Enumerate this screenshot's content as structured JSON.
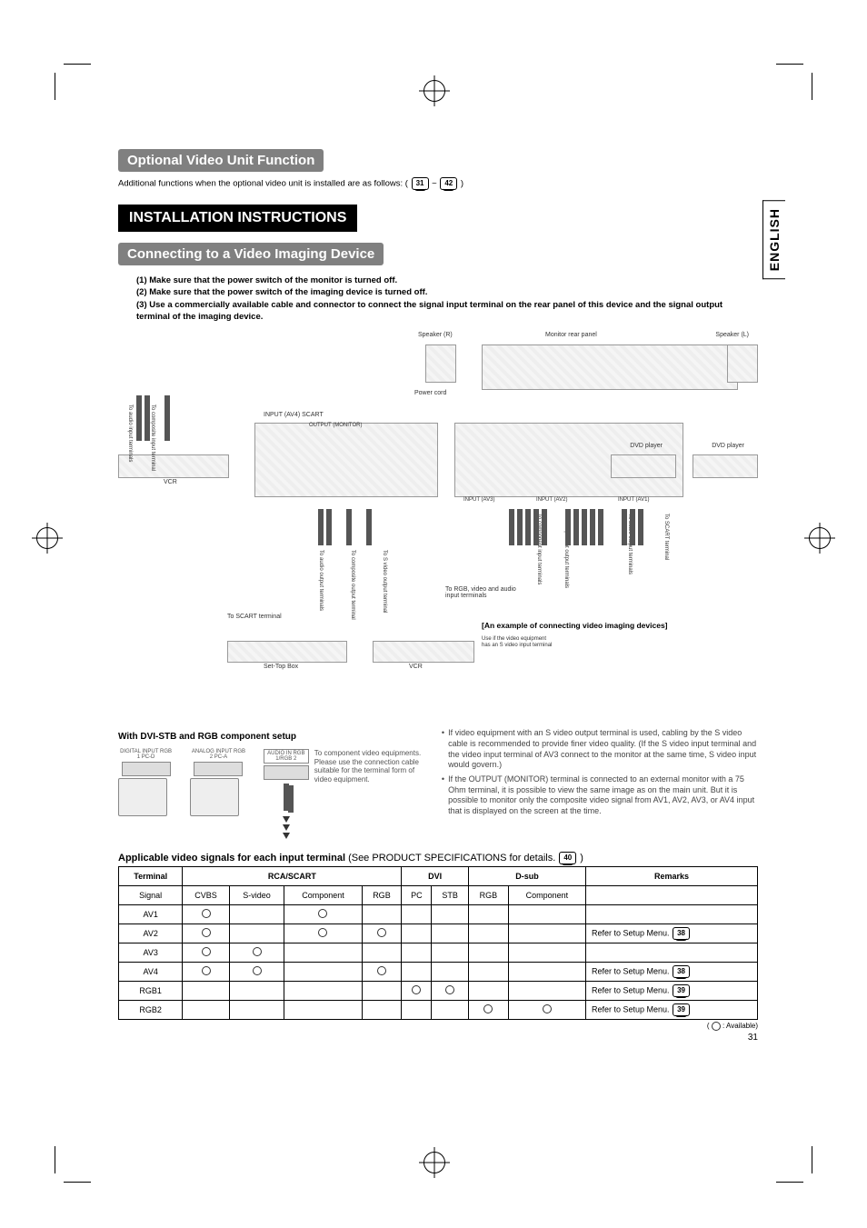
{
  "lang_tab": "ENGLISH",
  "sections": {
    "optional": "Optional Video Unit Function",
    "install": "INSTALLATION INSTRUCTIONS",
    "connect": "Connecting to a Video Imaging Device"
  },
  "additional_prefix": "Additional functions when the optional video unit is installed are as follows: (",
  "additional_p1": "31",
  "additional_sep": " ~ ",
  "additional_p2": "42",
  "additional_suffix": " )",
  "instructions": {
    "l1": "(1) Make sure that the power switch of the monitor is turned off.",
    "l2": "(2) Make sure that the power switch of the imaging device is turned off.",
    "l3": "(3) Use a commercially available cable and connector to connect the signal input terminal on the rear panel of this device and the signal output terminal of the imaging device."
  },
  "diagram": {
    "speaker_r": "Speaker (R)",
    "speaker_l": "Speaker (L)",
    "rear_panel": "Monitor rear panel",
    "power_cord": "Power cord",
    "vcr": "VCR",
    "vcr2": "VCR",
    "settop": "Set-Top Box",
    "dvd1": "DVD player",
    "dvd2": "DVD player",
    "example": "[An example of connecting video imaging devices]",
    "to_scart": "To SCART terminal",
    "to_audio_in": "To audio input terminals",
    "to_composite_in": "To composite input terminal",
    "to_audio_out": "To audio output terminals",
    "to_composite_out": "To composite output terminal",
    "to_svideo_out": "To S video output terminal",
    "to_rgb": "To RGB, video and audio input terminals",
    "to_comp_in": "To component input terminals",
    "to_comp_out": "To component output terminals",
    "to_audio_out2": "To audio output terminals",
    "to_scart2": "To SCART terminal",
    "svideo_note": "Use if the video equipment has an S video input terminal",
    "input_av4": "INPUT (AV4) SCART",
    "output_mon": "OUTPUT (MONITOR)",
    "input_av3": "INPUT (AV3)",
    "input_av2": "INPUT (AV2)",
    "input_av1": "INPUT (AV1)"
  },
  "setup": {
    "title": "With DVI-STB and RGB component setup",
    "labels": {
      "rgb1": "DIGITAL INPUT RGB 1 PC-D",
      "rgb2": "ANALOG INPUT RGB 2 PC-A",
      "audio": "AUDIO IN RGB 1/RGB 2"
    },
    "note": "To component video equipments. Please use the connection cable suitable for the terminal form of video equipment."
  },
  "right_notes": {
    "n1": "If video equipment with an S video output terminal is used, cabling by the S video cable is recommended to provide finer video quality. (If the S video input terminal and the video input terminal of AV3 connect to the monitor at the same time, S video input would govern.)",
    "n2": "If the OUTPUT (MONITOR) terminal is connected to an external monitor with a 75 Ohm terminal, it is possible to view the same image as on the main unit. But it is possible to monitor only the composite video signal from AV1, AV2, AV3, or AV4 input that is displayed on the screen at the time."
  },
  "table_title_prefix": "Applicable video signals for each input terminal ",
  "table_title_mid": "(See PRODUCT SPECIFICATIONS for details. ",
  "table_title_page": "40",
  "table_title_suffix": " )",
  "table": {
    "headers": {
      "terminal": "Terminal",
      "rca": "RCA/SCART",
      "dvi": "DVI",
      "dsub": "D-sub",
      "remarks": "Remarks",
      "signal": "Signal",
      "cvbs": "CVBS",
      "svideo": "S-video",
      "component": "Component",
      "rgb": "RGB",
      "pc": "PC",
      "stb": "STB",
      "rgb2": "RGB",
      "component2": "Component"
    },
    "rows": {
      "av1": "AV1",
      "av2": "AV2",
      "av3": "AV3",
      "av4": "AV4",
      "rgb1": "RGB1",
      "rgb2": "RGB2"
    },
    "remark_refer": "Refer to Setup Menu.",
    "p38": "38",
    "p39": "39"
  },
  "available_legend_prefix": "( ",
  "available_legend_suffix": " : Available)",
  "page_number": "31"
}
